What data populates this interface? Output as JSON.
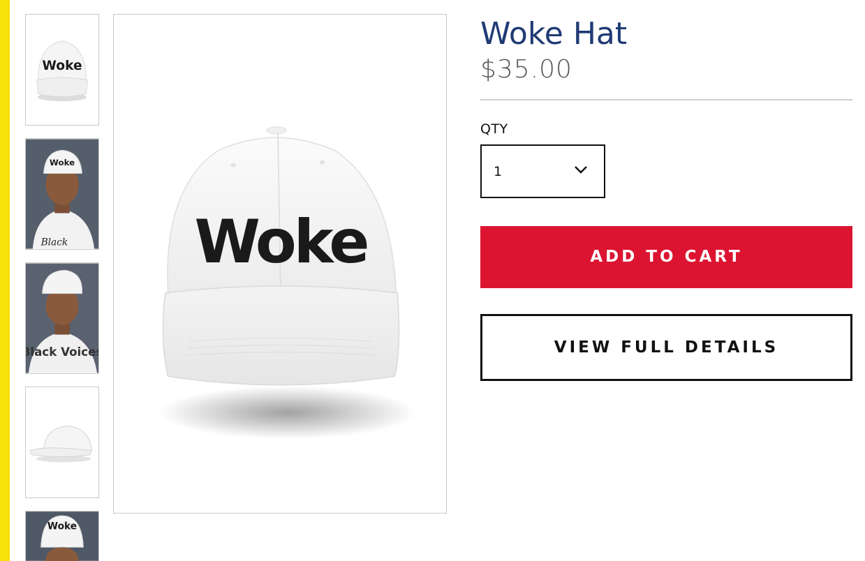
{
  "product": {
    "title": "Woke Hat",
    "price": "$35.00",
    "cap_text": "Woke"
  },
  "thumbnails": [
    {
      "name": "front view",
      "text": "Woke"
    },
    {
      "name": "model front",
      "text": "Woke"
    },
    {
      "name": "model backwards",
      "text": "Black Voices"
    },
    {
      "name": "side view",
      "text": ""
    },
    {
      "name": "model partial",
      "text": "Woke"
    }
  ],
  "quantity": {
    "label": "QTY",
    "value": "1",
    "icon": "chevron-down-icon"
  },
  "actions": {
    "add_to_cart": "ADD TO CART",
    "view_full_details": "VIEW FULL DETAILS"
  },
  "colors": {
    "accent_yellow": "#f6e10b",
    "title_blue": "#1f3a73",
    "cart_red": "#dc1431"
  }
}
